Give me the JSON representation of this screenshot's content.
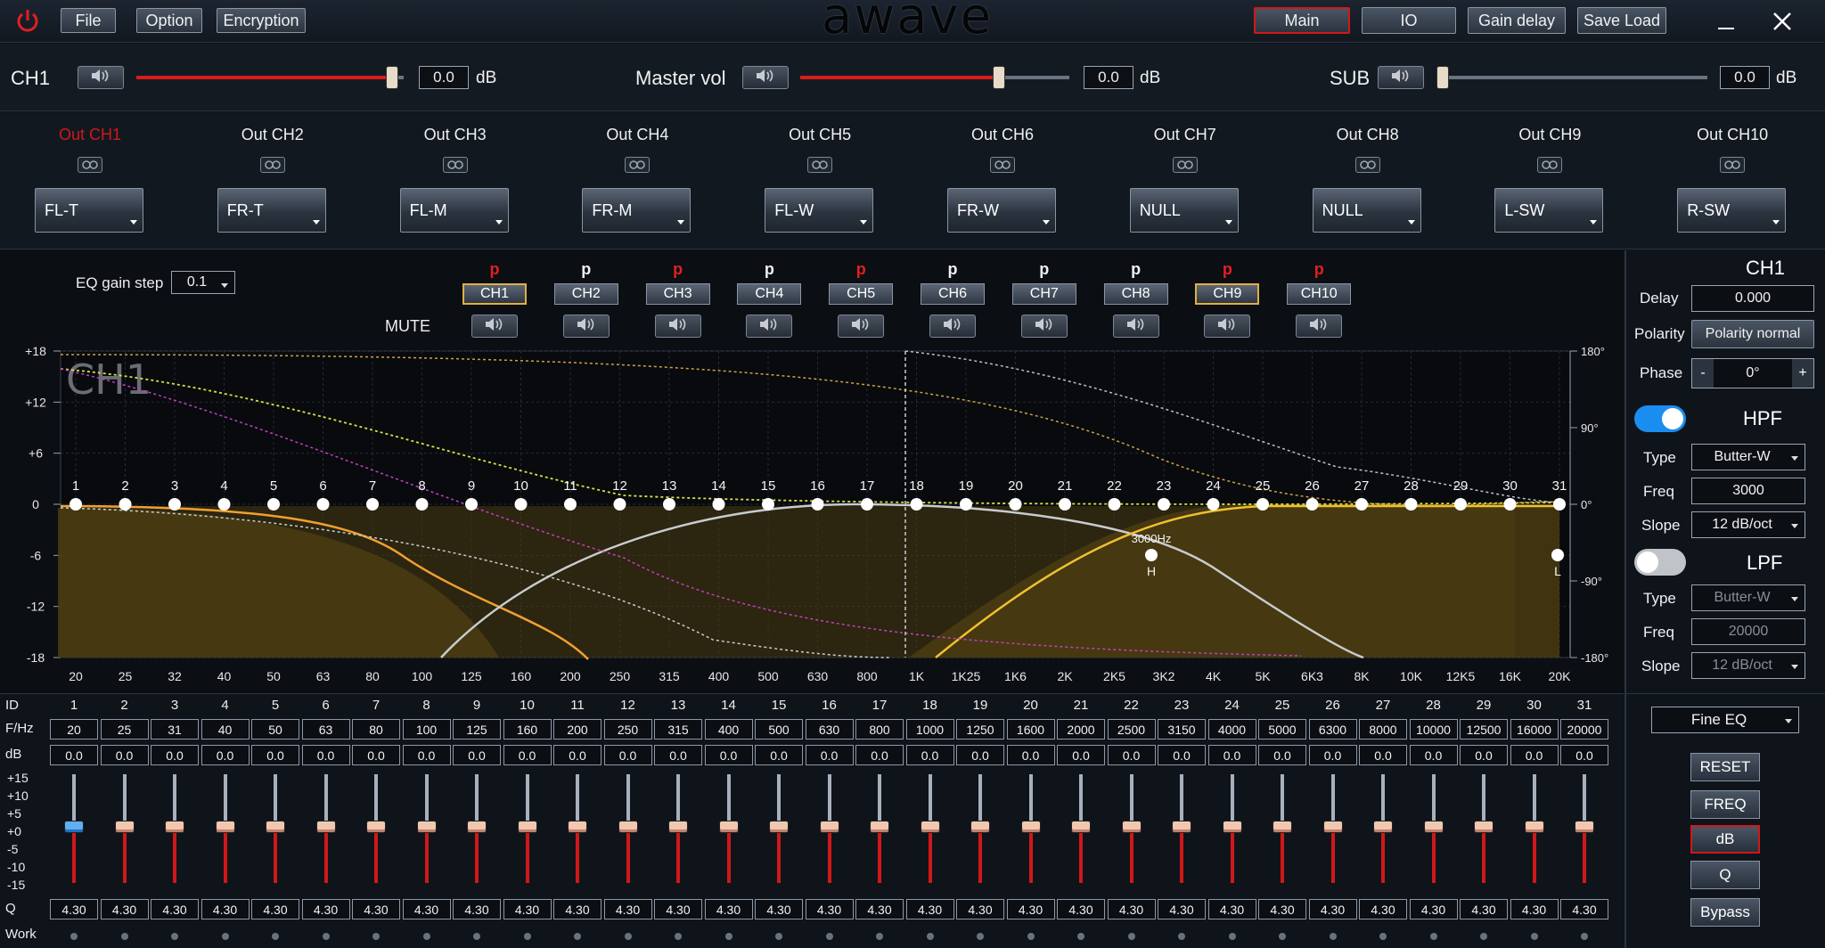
{
  "menu": {
    "file": "File",
    "option": "Option",
    "encryption": "Encryption"
  },
  "logo": "awave",
  "nav": {
    "main": "Main",
    "io": "IO",
    "gain_delay": "Gain delay",
    "save_load": "Save Load"
  },
  "volume": {
    "ch_label": "CH1",
    "ch_value": "0.0",
    "ch_level": 0.98,
    "master_label": "Master vol",
    "master_value": "0.0",
    "master_level": 0.75,
    "sub_label": "SUB",
    "sub_value": "0.0",
    "sub_level": 0.0,
    "unit": "dB"
  },
  "outputs": [
    {
      "name": "Out CH1",
      "assign": "FL-T",
      "active": true
    },
    {
      "name": "Out CH2",
      "assign": "FR-T"
    },
    {
      "name": "Out CH3",
      "assign": "FL-M"
    },
    {
      "name": "Out CH4",
      "assign": "FR-M"
    },
    {
      "name": "Out CH5",
      "assign": "FL-W"
    },
    {
      "name": "Out CH6",
      "assign": "FR-W"
    },
    {
      "name": "Out CH7",
      "assign": "NULL"
    },
    {
      "name": "Out CH8",
      "assign": "NULL"
    },
    {
      "name": "Out CH9",
      "assign": "L-SW"
    },
    {
      "name": "Out CH10",
      "assign": "R-SW"
    }
  ],
  "eq": {
    "gain_step_label": "EQ gain step",
    "gain_step_value": "0.1",
    "mute_label": "MUTE",
    "phase_marker": "p",
    "channels": [
      {
        "label": "CH1",
        "p_red": true,
        "selected": true
      },
      {
        "label": "CH2",
        "p_red": false
      },
      {
        "label": "CH3",
        "p_red": true
      },
      {
        "label": "CH4",
        "p_red": false
      },
      {
        "label": "CH5",
        "p_red": true
      },
      {
        "label": "CH6",
        "p_red": false
      },
      {
        "label": "CH7",
        "p_red": false
      },
      {
        "label": "CH8",
        "p_red": false
      },
      {
        "label": "CH9",
        "p_red": true,
        "selected": true
      },
      {
        "label": "CH10",
        "p_red": true
      }
    ]
  },
  "graph": {
    "watermark": "CH1",
    "y_ticks": [
      "+18",
      "+12",
      "+6",
      "0",
      "-6",
      "-12",
      "-18"
    ],
    "phase_ticks": [
      "180°",
      "90°",
      "0°",
      "-90°",
      "-180°"
    ],
    "x_ticks": [
      "20",
      "25",
      "32",
      "40",
      "50",
      "63",
      "80",
      "100",
      "125",
      "160",
      "200",
      "250",
      "315",
      "400",
      "500",
      "630",
      "800",
      "1K",
      "1K25",
      "1K6",
      "2K",
      "2K5",
      "3K2",
      "4K",
      "5K",
      "6K3",
      "8K",
      "10K",
      "12K5",
      "16K",
      "20K"
    ],
    "hpf_marker": "3000Hz",
    "h_label": "H",
    "l_label": "L"
  },
  "bands": {
    "row_labels": {
      "id": "ID",
      "freq": "F/Hz",
      "db": "dB",
      "q": "Q",
      "work": "Work"
    },
    "slider_scale": [
      "+15",
      "+10",
      "+5",
      "+0",
      "-5",
      "-10",
      "-15"
    ],
    "freqs": [
      "20",
      "25",
      "31",
      "40",
      "50",
      "63",
      "80",
      "100",
      "125",
      "160",
      "200",
      "250",
      "315",
      "400",
      "500",
      "630",
      "800",
      "1000",
      "1250",
      "1600",
      "2000",
      "2500",
      "3150",
      "4000",
      "5000",
      "6300",
      "8000",
      "10000",
      "12500",
      "16000",
      "20000"
    ],
    "gain": "0.0",
    "q": "4.30"
  },
  "side": {
    "channel": "CH1",
    "delay_label": "Delay",
    "delay_value": "0.000",
    "polarity_label": "Polarity",
    "polarity_value": "Polarity normal",
    "phase_label": "Phase",
    "phase_minus": "-",
    "phase_value": "0°",
    "phase_plus": "+",
    "hpf": {
      "title": "HPF",
      "enabled": true,
      "type_label": "Type",
      "type": "Butter-W",
      "freq_label": "Freq",
      "freq": "3000",
      "slope_label": "Slope",
      "slope": "12 dB/oct"
    },
    "lpf": {
      "title": "LPF",
      "enabled": false,
      "type_label": "Type",
      "type": "Butter-W",
      "freq_label": "Freq",
      "freq": "20000",
      "slope_label": "Slope",
      "slope": "12 dB/oct"
    },
    "eq_mode": "Fine EQ",
    "buttons": {
      "reset": "RESET",
      "freq": "FREQ",
      "db": "dB",
      "q": "Q",
      "bypass": "Bypass"
    }
  },
  "colors": {
    "accent_red": "#d01818",
    "curve_orange": "#f0a030",
    "curve_white": "#c8ccd0",
    "curve_yellow": "#f0c030",
    "fill": "#4a3c10"
  }
}
